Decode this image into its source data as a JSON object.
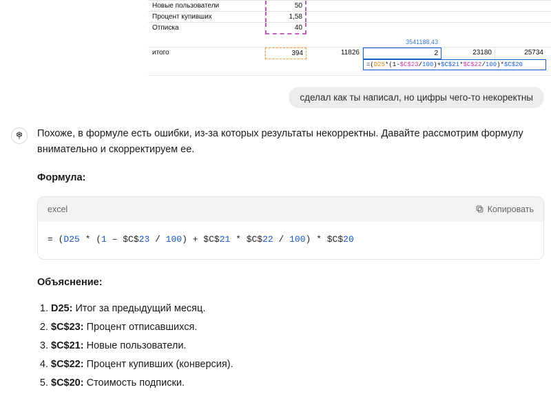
{
  "screenshot": {
    "rows": [
      {
        "label": "Новые пользователи",
        "value": "50"
      },
      {
        "label": "Процент купивших",
        "value": "1,58"
      },
      {
        "label": "Отписка",
        "value": "40"
      }
    ],
    "itogo_label": "итого",
    "itogo": {
      "v1": "394",
      "v2": "11826",
      "hint": "3541188,43",
      "v3": "2",
      "v4": "23180",
      "v5": "25734"
    },
    "formula_parts": {
      "a": "=(",
      "d25": "D25",
      "b": "*(1-",
      "c23": "$C$23",
      "c": "/",
      "h1": "100",
      "d": ")+",
      "c21": "$C$21",
      "e": "*",
      "c22": "$C$22",
      "f": "/",
      "h2": "100",
      "g": ")*",
      "c20": "$C$20"
    }
  },
  "user_bubble": "сделал как ты написал, но цифры чего-то некоректны",
  "assistant": {
    "intro": "Похоже, в формуле есть ошибки, из-за которых результаты некорректны. Давайте рассмотрим формулу внимательно и скорректируем ее.",
    "h_formula": "Формула:",
    "code_lang": "excel",
    "copy_label": "Копировать",
    "code_parts": {
      "a": "= (",
      "d25": "D25",
      "b": " * (",
      "one": "1",
      "c": " – $C$",
      "n23": "23",
      "d": " / ",
      "h1": "100",
      "e": ") + $C$",
      "n21": "21",
      "f": " * $C$",
      "n22": "22",
      "g": " / ",
      "h2": "100",
      "h": ") * $C$",
      "n20": "20"
    },
    "h_explain": "Объяснение:",
    "items": [
      {
        "ref": "D25:",
        "text": " Итог за предыдущий месяц."
      },
      {
        "ref": "$C$23:",
        "text": " Процент отписавшихся."
      },
      {
        "ref": "$C$21:",
        "text": " Новые пользователи."
      },
      {
        "ref": "$C$22:",
        "text": " Процент купивших (конверсия)."
      },
      {
        "ref": "$C$20:",
        "text": " Стоимость подписки."
      }
    ]
  }
}
